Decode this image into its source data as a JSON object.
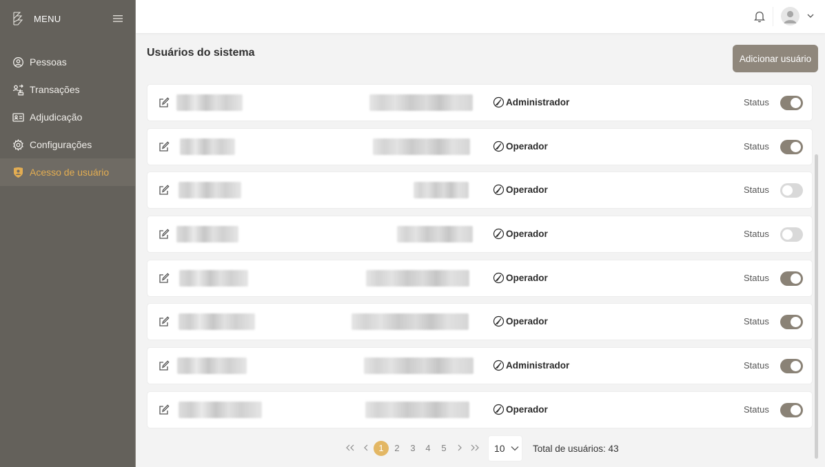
{
  "sidebar": {
    "menu_label": "MENU",
    "items": [
      {
        "label": "Pessoas",
        "icon": "person-circle-icon"
      },
      {
        "label": "Transações",
        "icon": "transactions-icon"
      },
      {
        "label": "Adjudicação",
        "icon": "id-card-icon"
      },
      {
        "label": "Configurações",
        "icon": "gear-icon"
      },
      {
        "label": "Acesso de usuário",
        "icon": "user-badge-icon",
        "active": true
      }
    ]
  },
  "main": {
    "title": "Usuários do sistema",
    "add_button": "Adicionar usuário"
  },
  "users": [
    {
      "role": "Administrador",
      "status_label": "Status",
      "enabled": true
    },
    {
      "role": "Operador",
      "status_label": "Status",
      "enabled": true
    },
    {
      "role": "Operador",
      "status_label": "Status",
      "enabled": false
    },
    {
      "role": "Operador",
      "status_label": "Status",
      "enabled": false
    },
    {
      "role": "Operador",
      "status_label": "Status",
      "enabled": true
    },
    {
      "role": "Operador",
      "status_label": "Status",
      "enabled": true
    },
    {
      "role": "Administrador",
      "status_label": "Status",
      "enabled": true
    },
    {
      "role": "Operador",
      "status_label": "Status",
      "enabled": true
    }
  ],
  "pagination": {
    "first": "«",
    "prev": "‹",
    "pages": [
      "1",
      "2",
      "3",
      "4",
      "5"
    ],
    "current": "1",
    "next": "›",
    "last": "»",
    "page_size": "10",
    "total_text": "Total de usuários: 43"
  },
  "colors": {
    "sidebar_bg": "#64615b",
    "accent": "#e3ad52",
    "button_bg": "#8f877c",
    "toggle_on": "#8a8276"
  }
}
